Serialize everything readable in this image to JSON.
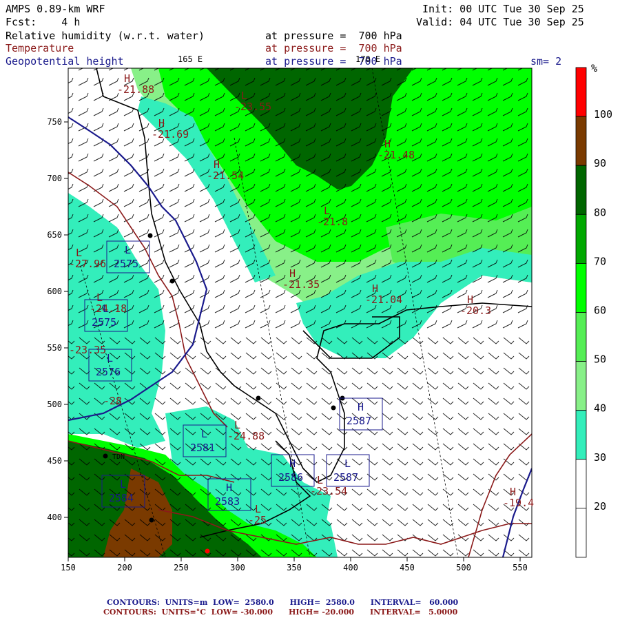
{
  "header": {
    "model": "AMPS 0.89-km WRF",
    "init": "Init: 00 UTC Tue 30 Sep 25",
    "fcst": "Fcst:    4 h",
    "valid": "Valid: 04 UTC Tue 30 Sep 25",
    "var1": "Relative humidity (w.r.t. water)",
    "var1_level": "at pressure =  700 hPa",
    "var2": "Temperature",
    "var2_level": "at pressure =  700 hPa",
    "var3": "Geopotential height",
    "var3_level": "at pressure =  700 hPa",
    "smoothing": "sm= 2",
    "lon_label_165": "165 E",
    "lon_label_170": "170 E"
  },
  "colors": {
    "rh_100": "#ff0000",
    "rh_90": "#7a3a00",
    "rh_80": "#006600",
    "rh_70": "#00a800",
    "rh_60": "#00ff00",
    "rh_50": "#55ee55",
    "rh_40": "#88f088",
    "rh_30": "#33eebb",
    "rh_20": "#ffffff",
    "rh_10": "#ffffff",
    "temp": "#8b1a1a",
    "height": "#1a1a8c"
  },
  "legend": {
    "unit": "%",
    "labels": [
      "100",
      "90",
      "80",
      "70",
      "60",
      "50",
      "40",
      "30",
      "20"
    ]
  },
  "axes": {
    "x_ticks": [
      "150",
      "200",
      "250",
      "300",
      "350",
      "400",
      "450",
      "500",
      "550"
    ],
    "y_ticks": [
      "750",
      "700",
      "650",
      "600",
      "550",
      "500",
      "450",
      "400"
    ]
  },
  "highs_lows": [
    {
      "sym": "H",
      "val": "-21.88"
    },
    {
      "sym": "L",
      "val": "-23.55"
    },
    {
      "sym": "H",
      "val": "-21.69"
    },
    {
      "sym": "H",
      "val": "-21.54"
    },
    {
      "sym": "H",
      "val": "-21.48"
    },
    {
      "sym": "L",
      "val": "-21.8"
    },
    {
      "sym": "H",
      "val": "-21.35"
    },
    {
      "sym": "H",
      "val": "-21.04"
    },
    {
      "sym": "H",
      "val": "-20.3"
    },
    {
      "sym": "L",
      "val": "-27.96"
    },
    {
      "sym": "L",
      "val": "-24.18"
    },
    {
      "sym": "",
      "val": "-23.35"
    },
    {
      "sym": "",
      "val": "-28"
    },
    {
      "sym": "L",
      "val": "-24.88"
    },
    {
      "sym": "L",
      "val": "-23.54"
    },
    {
      "sym": "H",
      "val": "-19.4"
    },
    {
      "sym": "L",
      "val": "-25"
    }
  ],
  "height_boxes": [
    {
      "sym": "L",
      "val": "2575"
    },
    {
      "sym": "L",
      "val": "2575"
    },
    {
      "sym": "L",
      "val": "2576"
    },
    {
      "sym": "H",
      "val": "2587"
    },
    {
      "sym": "L",
      "val": "2581"
    },
    {
      "sym": "H",
      "val": "2586"
    },
    {
      "sym": "L",
      "val": "2587"
    },
    {
      "sym": "L",
      "val": "2584"
    },
    {
      "sym": "H",
      "val": "2583"
    }
  ],
  "station_label": "TDN",
  "footer": {
    "line1": "CONTOURS:  UNITS=m  LOW=  2580.0      HIGH=  2580.0      INTERVAL=   60.000",
    "line2": "CONTOURS:  UNITS=°C  LOW= -30.000      HIGH= -20.000      INTERVAL=   5.0000"
  }
}
